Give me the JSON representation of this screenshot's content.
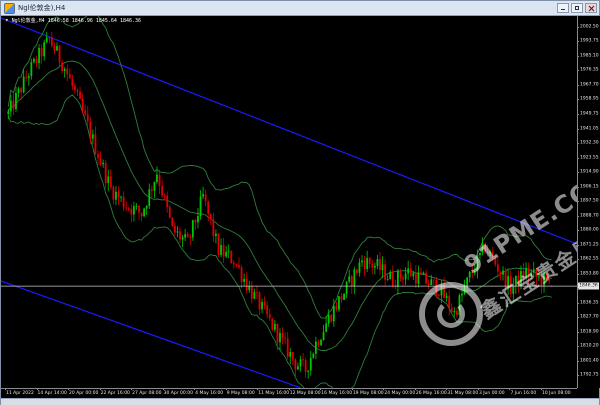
{
  "window": {
    "title": "Ngl伦敦金),H4",
    "symbol_line": {
      "arrow": "▾",
      "text": "Ngl伦敦金,H4  1846.58 1846.96 1845.64 1846.36"
    }
  },
  "watermark": {
    "brand": "91PME.COM",
    "sub": "鑫汇宝贵金属"
  },
  "chart_data": {
    "type": "candlestick",
    "title": "",
    "ylim": [
      1785,
      2009
    ],
    "y_ticks": [
      "2002.50",
      "1993.75",
      "1985.10",
      "1976.35",
      "1967.70",
      "1958.95",
      "1949.75",
      "1941.05",
      "1932.30",
      "1923.55",
      "1914.90",
      "1906.15",
      "1897.50",
      "1888.70",
      "1880.00",
      "1871.25",
      "1862.55",
      "1853.80",
      "1845.10",
      "1836.35",
      "1827.70",
      "1818.90",
      "1810.20",
      "1801.40",
      "1792.75"
    ],
    "x_ticks": [
      "11 Apr 2022",
      "14 Apr 14:00",
      "20 Apr 00:00",
      "22 Apr 16:00",
      "27 Apr 08:00",
      "30 Apr 00:00",
      "4 May 16:00",
      "9 May 08:00",
      "11 May 16:00",
      "12 May 08:00",
      "16 May 16:00",
      "19 May 08:00",
      "24 May 00:00",
      "26 May 16:00",
      "31 May 08:00",
      "3 Jun 00:00",
      "7 Jun 16:00",
      "10 Jun 08:00"
    ],
    "current_price": "1846.36",
    "current_price_value": 1846.36,
    "up_color": "#00c800",
    "down_color": "#e00000",
    "bands_color": "#2f7d3a",
    "channel_color": "#1a1aff",
    "price_anchors": [
      [
        0,
        1950
      ],
      [
        8,
        1975
      ],
      [
        16,
        1995
      ],
      [
        22,
        1978
      ],
      [
        28,
        1955
      ],
      [
        34,
        1930
      ],
      [
        40,
        1905
      ],
      [
        46,
        1895
      ],
      [
        52,
        1890
      ],
      [
        58,
        1915
      ],
      [
        64,
        1880
      ],
      [
        70,
        1872
      ],
      [
        76,
        1900
      ],
      [
        82,
        1868
      ],
      [
        88,
        1862
      ],
      [
        94,
        1845
      ],
      [
        100,
        1830
      ],
      [
        106,
        1815
      ],
      [
        112,
        1800
      ],
      [
        116,
        1796
      ],
      [
        120,
        1812
      ],
      [
        126,
        1830
      ],
      [
        132,
        1845
      ],
      [
        138,
        1862
      ],
      [
        144,
        1858
      ],
      [
        150,
        1850
      ],
      [
        156,
        1855
      ],
      [
        162,
        1850
      ],
      [
        168,
        1845
      ],
      [
        174,
        1830
      ],
      [
        180,
        1852
      ],
      [
        186,
        1870
      ],
      [
        190,
        1860
      ],
      [
        196,
        1845
      ],
      [
        202,
        1855
      ],
      [
        208,
        1850
      ],
      [
        212,
        1848
      ]
    ],
    "candle_count": 213,
    "last_candle": {
      "open": 1846.58,
      "high": 1846.96,
      "low": 1845.64,
      "close": 1846.36
    }
  }
}
